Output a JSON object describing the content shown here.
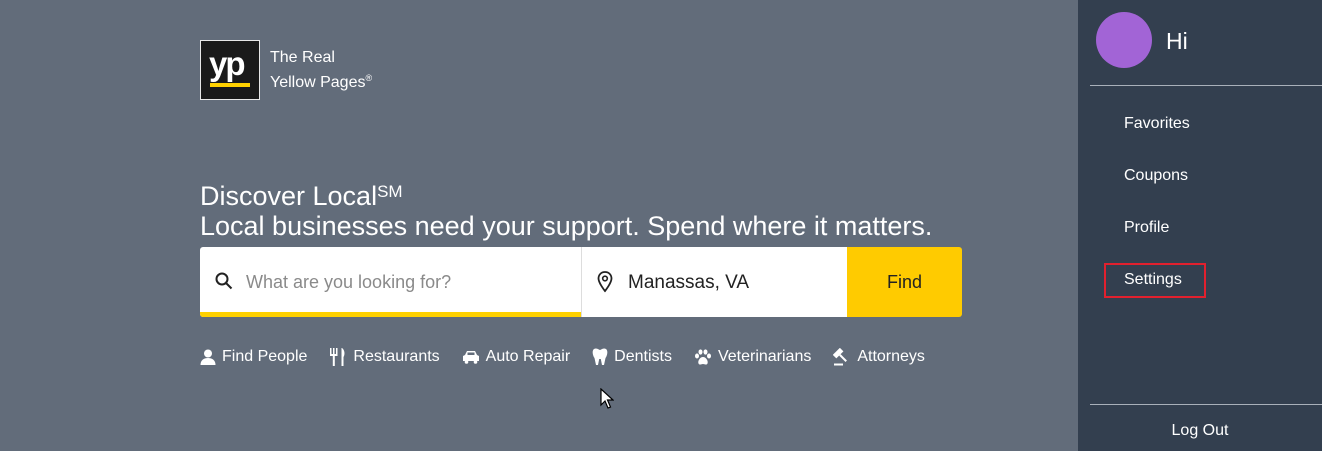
{
  "brand": {
    "logo_mark": "yp",
    "line1": "The Real",
    "line2": "Yellow Pages",
    "trademark": "®"
  },
  "hero": {
    "title": "Discover Local",
    "title_mark": "SM",
    "subtitle": "Local businesses need your support. Spend where it matters."
  },
  "search": {
    "what_placeholder": "What are you looking for?",
    "where_value": "Manassas, VA",
    "find_label": "Find"
  },
  "quick_links": [
    {
      "label": "Find People",
      "icon": "person-icon"
    },
    {
      "label": "Restaurants",
      "icon": "fork-knife-icon"
    },
    {
      "label": "Auto Repair",
      "icon": "car-icon"
    },
    {
      "label": "Dentists",
      "icon": "tooth-icon"
    },
    {
      "label": "Veterinarians",
      "icon": "paw-icon"
    },
    {
      "label": "Attorneys",
      "icon": "gavel-icon"
    }
  ],
  "sidebar": {
    "greeting": "Hi",
    "menu": [
      {
        "label": "Favorites"
      },
      {
        "label": "Coupons"
      },
      {
        "label": "Profile"
      },
      {
        "label": "Settings"
      }
    ],
    "logout_label": "Log Out"
  },
  "colors": {
    "main_bg": "#626c7a",
    "sidebar_bg": "#333f4f",
    "accent_yellow": "#ffcb00",
    "avatar": "#a264d6",
    "highlight_border": "#e2202e"
  }
}
